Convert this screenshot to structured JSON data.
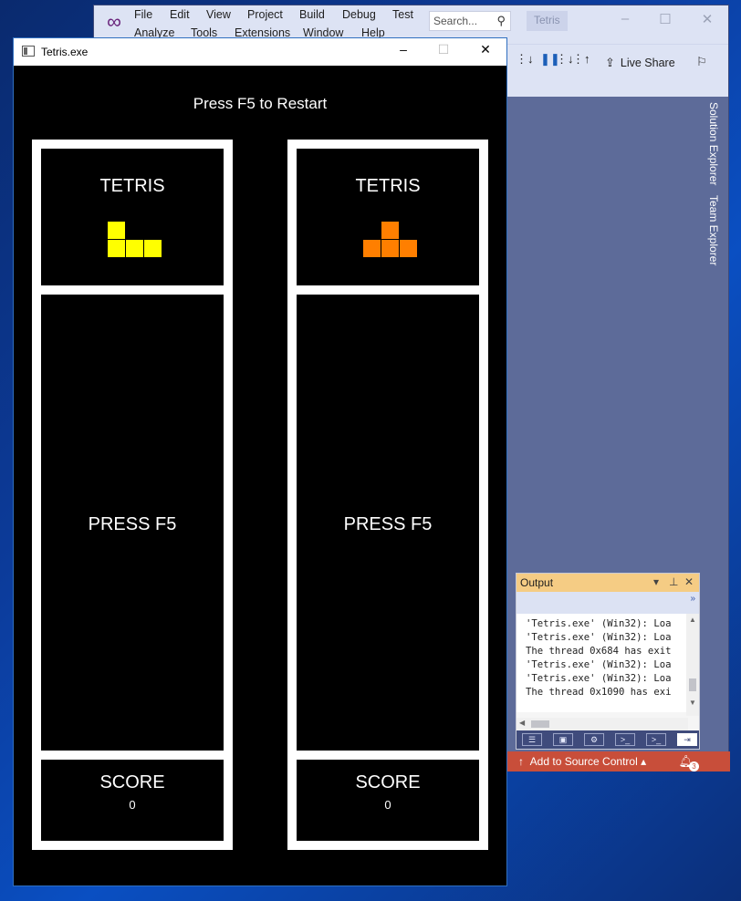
{
  "vs": {
    "menu": [
      "File",
      "Edit",
      "View",
      "Project",
      "Build",
      "Debug",
      "Test",
      "Analyze",
      "Tools",
      "Extensions",
      "Window",
      "Help"
    ],
    "search_placeholder": "Search...",
    "solution_name": "Tetris",
    "live_share": "Live Share",
    "side_tabs": [
      "Solution Explorer",
      "Team Explorer"
    ],
    "output": {
      "title": "Output",
      "lines": [
        "'Tetris.exe' (Win32): Loa",
        "'Tetris.exe' (Win32): Loa",
        "The thread 0x684 has exit",
        "'Tetris.exe' (Win32): Loa",
        "'Tetris.exe' (Win32): Loa",
        "The thread 0x1090 has exi"
      ]
    },
    "status": {
      "source_control": "Add to Source Control",
      "notification_count": "3"
    }
  },
  "game": {
    "window_title": "Tetris.exe",
    "restart_hint": "Press F5 to Restart",
    "players": [
      {
        "next_label": "TETRIS",
        "piece": "L",
        "piece_color": "#ffff00",
        "piece_shape": [
          [
            1,
            0,
            0
          ],
          [
            1,
            1,
            1
          ]
        ],
        "play_text": "PRESS F5",
        "score_label": "SCORE",
        "score": "0"
      },
      {
        "next_label": "TETRIS",
        "piece": "T",
        "piece_color": "#ff7f00",
        "piece_shape": [
          [
            0,
            1,
            0
          ],
          [
            1,
            1,
            1
          ]
        ],
        "play_text": "PRESS F5",
        "score_label": "SCORE",
        "score": "0"
      }
    ]
  },
  "colors": {
    "vs_chrome": "#dde3f4",
    "vs_background": "#5d6b99",
    "output_header": "#f5cc84",
    "status_bar": "#c84e3a"
  }
}
